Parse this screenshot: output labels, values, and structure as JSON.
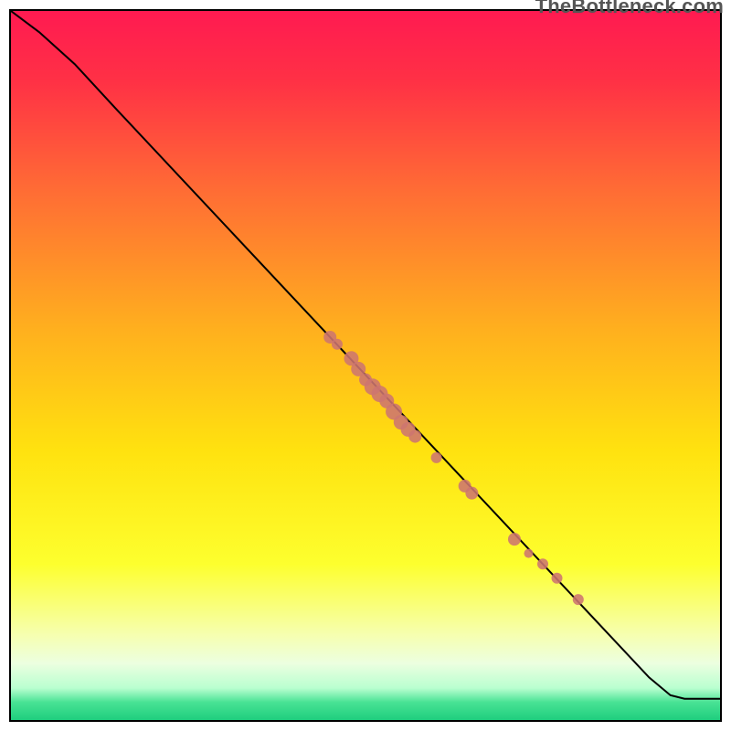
{
  "watermark": "TheBottleneck.com",
  "chart_data": {
    "type": "line",
    "title": "",
    "xlabel": "",
    "ylabel": "",
    "xlim": [
      0,
      100
    ],
    "ylim": [
      0,
      100
    ],
    "curve": [
      {
        "x": 0,
        "y": 100
      },
      {
        "x": 4,
        "y": 97
      },
      {
        "x": 9,
        "y": 92.5
      },
      {
        "x": 15,
        "y": 86
      },
      {
        "x": 90,
        "y": 6
      },
      {
        "x": 93,
        "y": 3.5
      },
      {
        "x": 95,
        "y": 3
      },
      {
        "x": 100,
        "y": 3
      }
    ],
    "scatter_points": [
      {
        "x": 45,
        "y": 54,
        "r": 7
      },
      {
        "x": 46,
        "y": 53,
        "r": 6
      },
      {
        "x": 48,
        "y": 51,
        "r": 8
      },
      {
        "x": 49,
        "y": 49.5,
        "r": 8
      },
      {
        "x": 50,
        "y": 48,
        "r": 7
      },
      {
        "x": 51,
        "y": 47,
        "r": 9
      },
      {
        "x": 52,
        "y": 46,
        "r": 9
      },
      {
        "x": 53,
        "y": 45,
        "r": 8
      },
      {
        "x": 54,
        "y": 43.5,
        "r": 9
      },
      {
        "x": 55,
        "y": 42,
        "r": 8
      },
      {
        "x": 56,
        "y": 41,
        "r": 8
      },
      {
        "x": 57,
        "y": 40,
        "r": 7
      },
      {
        "x": 60,
        "y": 37,
        "r": 6
      },
      {
        "x": 64,
        "y": 33,
        "r": 7
      },
      {
        "x": 65,
        "y": 32,
        "r": 7
      },
      {
        "x": 71,
        "y": 25.5,
        "r": 7
      },
      {
        "x": 73,
        "y": 23.5,
        "r": 5
      },
      {
        "x": 75,
        "y": 22,
        "r": 6
      },
      {
        "x": 77,
        "y": 20,
        "r": 6
      },
      {
        "x": 80,
        "y": 17,
        "r": 6
      }
    ],
    "colors": {
      "gradient_stops": [
        {
          "offset": 0.0,
          "color": "#ff1a51"
        },
        {
          "offset": 0.1,
          "color": "#ff3145"
        },
        {
          "offset": 0.25,
          "color": "#ff6b35"
        },
        {
          "offset": 0.45,
          "color": "#ffb01e"
        },
        {
          "offset": 0.62,
          "color": "#ffe20f"
        },
        {
          "offset": 0.78,
          "color": "#fdff2e"
        },
        {
          "offset": 0.88,
          "color": "#f6ffb0"
        },
        {
          "offset": 0.92,
          "color": "#ecffe0"
        },
        {
          "offset": 0.955,
          "color": "#b9ffd0"
        },
        {
          "offset": 0.975,
          "color": "#48e294"
        },
        {
          "offset": 1.0,
          "color": "#1fce7e"
        }
      ],
      "point_fill": "#cd7570",
      "curve_stroke": "#000000"
    }
  }
}
